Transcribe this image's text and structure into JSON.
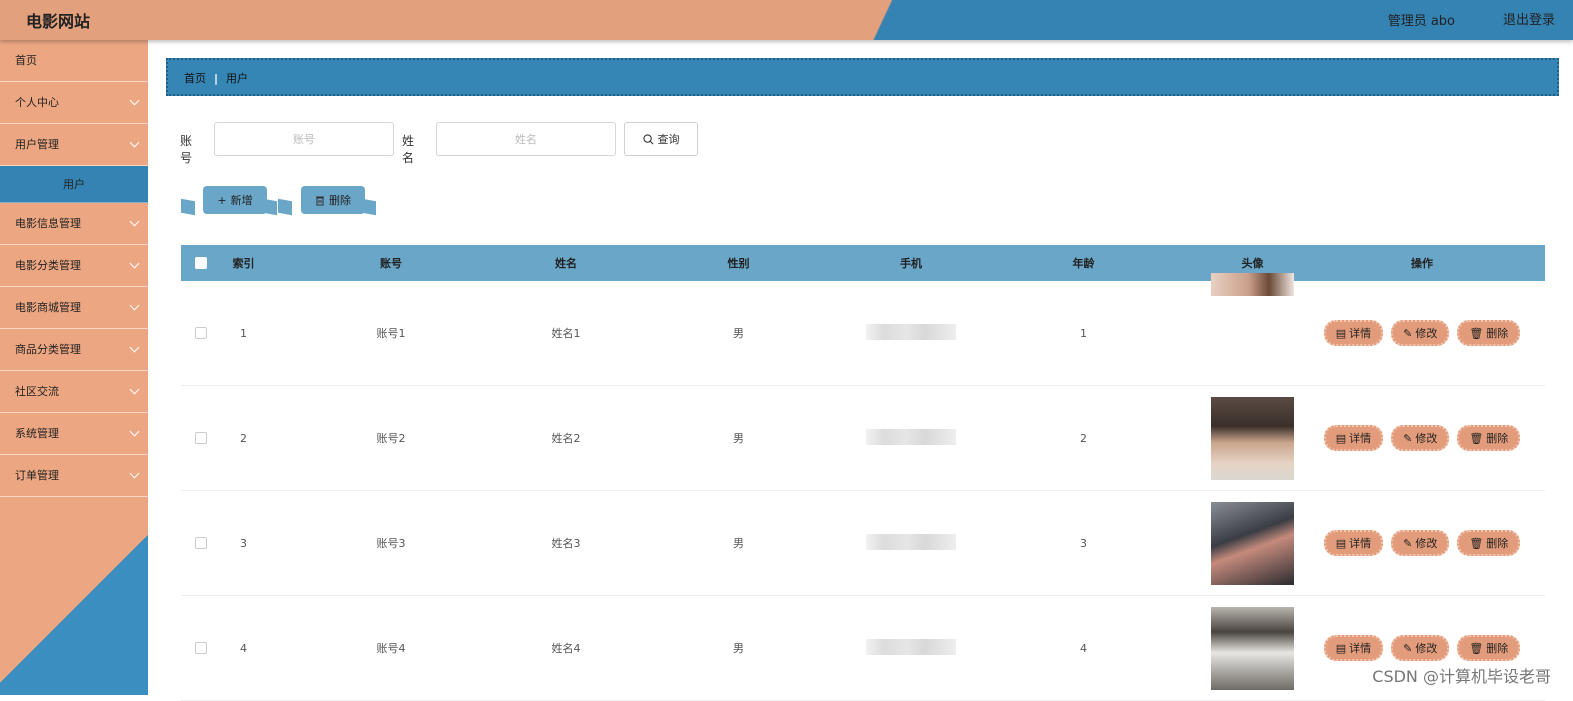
{
  "header": {
    "title": "电影网站",
    "user": "管理员 abo",
    "logout": "退出登录"
  },
  "sidebar": {
    "items": [
      {
        "label": "首页"
      },
      {
        "label": "个人中心"
      },
      {
        "label": "用户管理"
      },
      {
        "label": "用户"
      },
      {
        "label": "电影信息管理"
      },
      {
        "label": "电影分类管理"
      },
      {
        "label": "电影商城管理"
      },
      {
        "label": "商品分类管理"
      },
      {
        "label": "社区交流"
      },
      {
        "label": "系统管理"
      },
      {
        "label": "订单管理"
      }
    ]
  },
  "breadcrumb": {
    "home": "首页",
    "current": "用户"
  },
  "search": {
    "account_label": "账号",
    "account_placeholder": "账号",
    "name_label": "姓名",
    "name_placeholder": "姓名",
    "query_label": "查询"
  },
  "actions": {
    "add_label": "新增",
    "delete_label": "删除"
  },
  "table": {
    "headers": [
      "索引",
      "账号",
      "姓名",
      "性别",
      "手机",
      "年龄",
      "头像",
      "操作"
    ],
    "rows": [
      {
        "index": "1",
        "account": "账号1",
        "name": "姓名1",
        "gender": "男",
        "age": "1"
      },
      {
        "index": "2",
        "account": "账号2",
        "name": "姓名2",
        "gender": "男",
        "age": "2"
      },
      {
        "index": "3",
        "account": "账号3",
        "name": "姓名3",
        "gender": "男",
        "age": "3"
      },
      {
        "index": "4",
        "account": "账号4",
        "name": "姓名4",
        "gender": "男",
        "age": "4"
      }
    ],
    "ops": {
      "detail": "详情",
      "edit": "修改",
      "delete": "删除"
    }
  },
  "watermark": "CSDN @计算机毕设老哥",
  "colors": {
    "header_orange": "#e3a07c",
    "header_blue": "#3483b3",
    "table_header": "#6aa6c8",
    "op_button": "#e39c7b"
  }
}
